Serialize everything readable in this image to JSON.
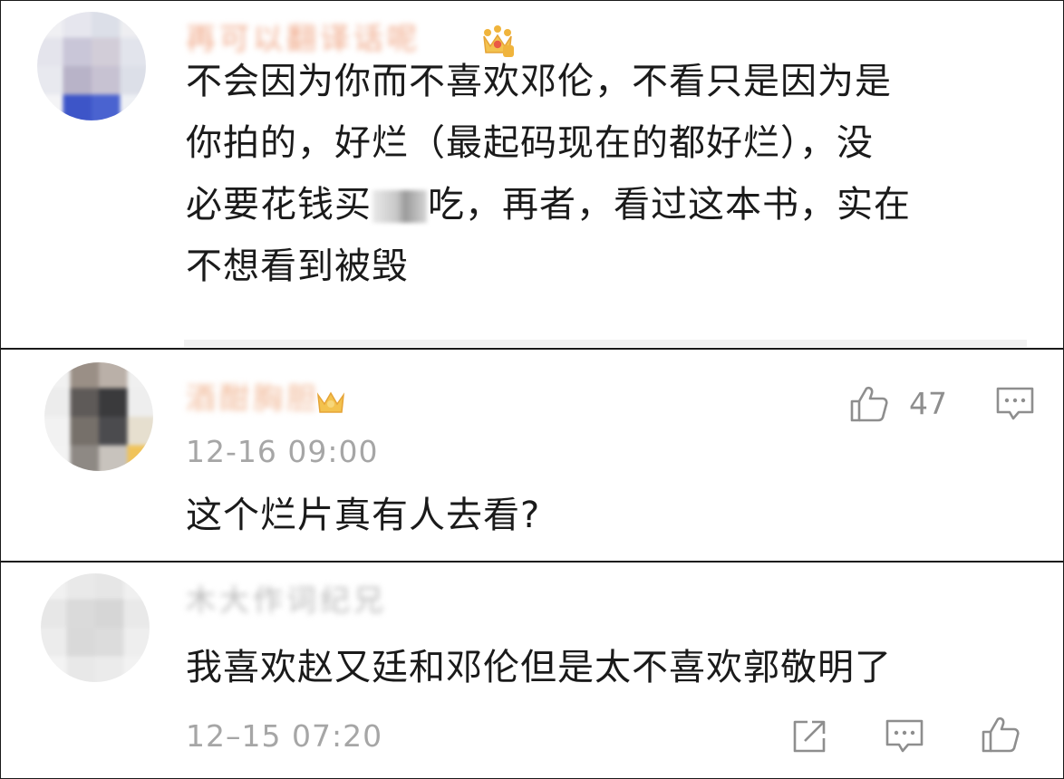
{
  "comments": [
    {
      "username": "再可以翻译话呢",
      "text_lines": [
        "不会因为你而不喜欢邓伦，不看只是因为是",
        "你拍的，好烂（最起码现在的都好烂），没",
        "必要花钱买",
        "不想看到被毁"
      ],
      "line3_after_blur": "吃，再者，看过这本书，实在"
    },
    {
      "username": "酒酣胸胆",
      "like_count": "47",
      "timestamp": "12-16 09:00",
      "text": "这个烂片真有人去看?"
    },
    {
      "username": "木大作词纪兄",
      "text": "我喜欢赵又廷和邓伦但是太不喜欢郭敬明了",
      "timestamp": "12–15 07:20"
    }
  ],
  "colors": {
    "text": "#1a1a1a",
    "meta": "#a6a6a6",
    "icon": "#8e8e8e",
    "crown": "#f0b43c",
    "username_blur": "#f2c6a8"
  },
  "icons": [
    "crown-badge-icon",
    "like-icon",
    "comment-icon",
    "share-icon"
  ]
}
